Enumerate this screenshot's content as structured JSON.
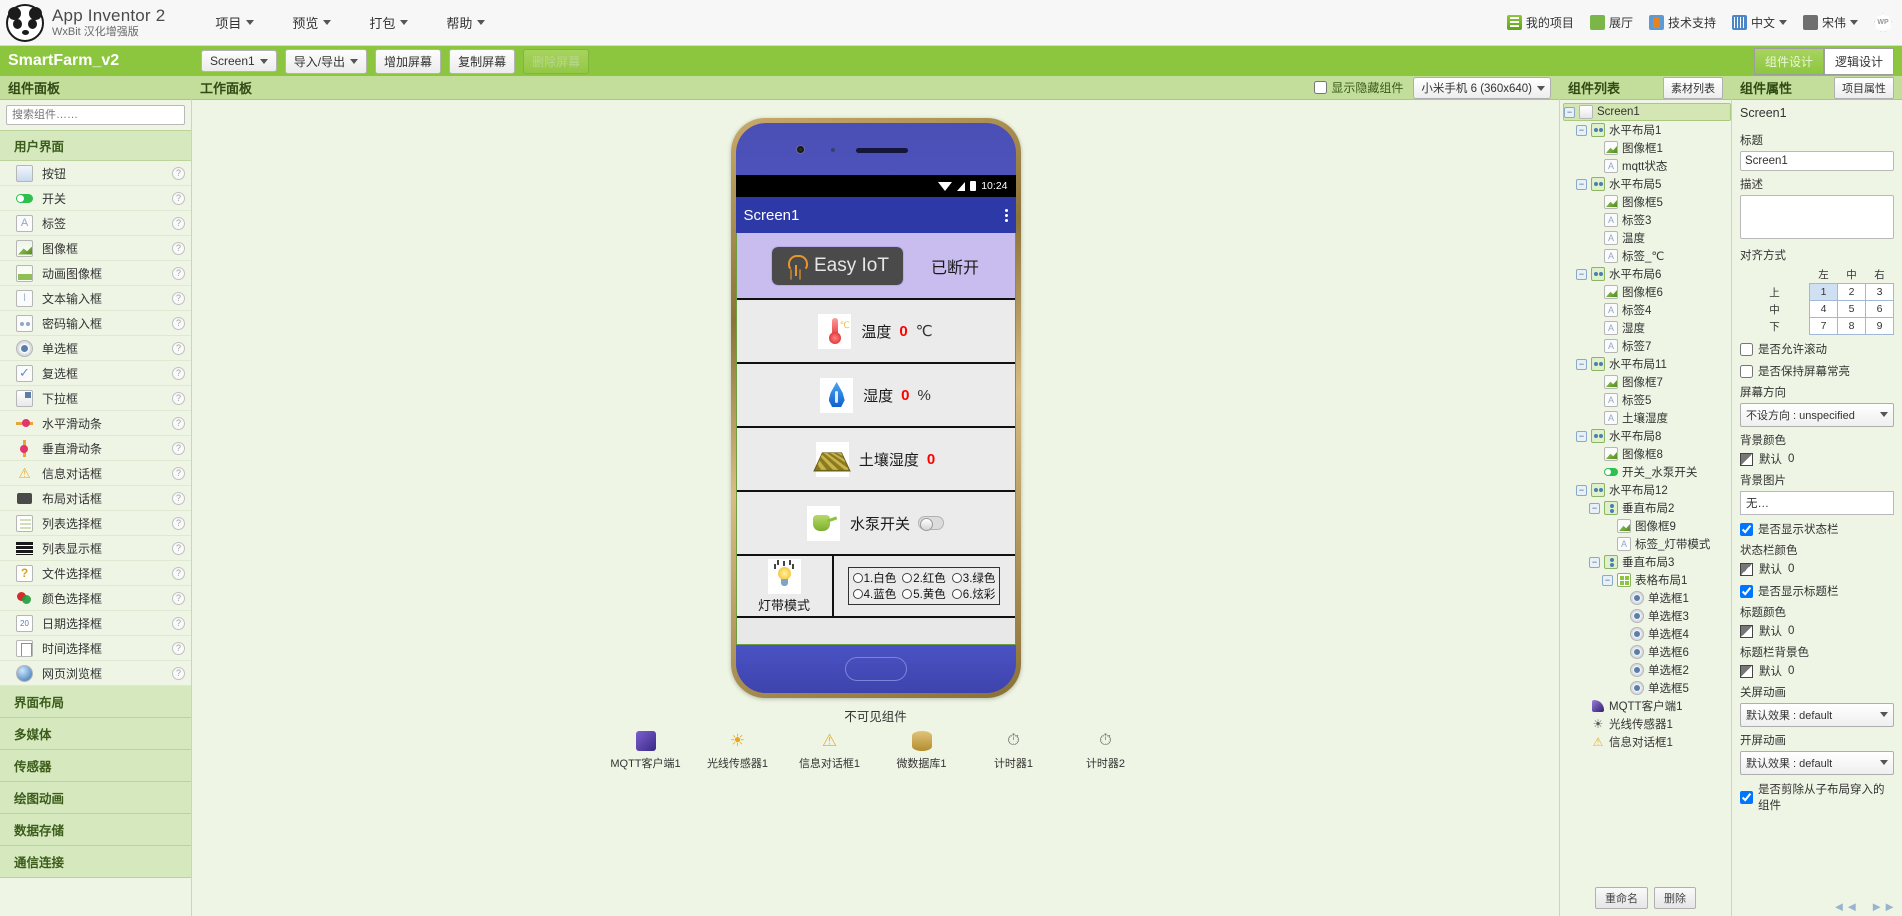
{
  "topbar": {
    "brand_title": "App Inventor 2",
    "brand_sub": "WxBit 汉化增强版",
    "menus": [
      "项目",
      "预览",
      "打包",
      "帮助"
    ],
    "right_items": [
      "我的项目",
      "展厅",
      "技术支持",
      "中文",
      "宋伟"
    ],
    "badge": "WP"
  },
  "projectbar": {
    "project_name": "SmartFarm_v2",
    "screen_select": "Screen1",
    "import_export": "导入/导出",
    "add_screen": "增加屏幕",
    "copy_screen": "复制屏幕",
    "delete_screen": "删除屏幕",
    "designer_tab": "组件设计",
    "blocks_tab": "逻辑设计"
  },
  "palette": {
    "header": "组件面板",
    "search_placeholder": "搜索组件……",
    "category_ui": "用户界面",
    "components": [
      {
        "label": "按钮",
        "icon": "button-icon"
      },
      {
        "label": "开关",
        "icon": "switch-icon"
      },
      {
        "label": "标签",
        "icon": "label-icon"
      },
      {
        "label": "图像框",
        "icon": "image-icon"
      },
      {
        "label": "动画图像框",
        "icon": "animated-image-icon"
      },
      {
        "label": "文本输入框",
        "icon": "textbox-icon"
      },
      {
        "label": "密码输入框",
        "icon": "password-icon"
      },
      {
        "label": "单选框",
        "icon": "radio-icon"
      },
      {
        "label": "复选框",
        "icon": "checkbox-icon"
      },
      {
        "label": "下拉框",
        "icon": "spinner-icon"
      },
      {
        "label": "水平滑动条",
        "icon": "horizontal-slider-icon"
      },
      {
        "label": "垂直滑动条",
        "icon": "vertical-slider-icon"
      },
      {
        "label": "信息对话框",
        "icon": "notifier-icon"
      },
      {
        "label": "布局对话框",
        "icon": "dialog-icon"
      },
      {
        "label": "列表选择框",
        "icon": "listpicker-icon"
      },
      {
        "label": "列表显示框",
        "icon": "listview-icon"
      },
      {
        "label": "文件选择框",
        "icon": "filepicker-icon"
      },
      {
        "label": "颜色选择框",
        "icon": "colorpicker-icon"
      },
      {
        "label": "日期选择框",
        "icon": "datepicker-icon"
      },
      {
        "label": "时间选择框",
        "icon": "timepicker-icon"
      },
      {
        "label": "网页浏览框",
        "icon": "webviewer-icon"
      }
    ],
    "other_categories": [
      "界面布局",
      "多媒体",
      "传感器",
      "绘图动画",
      "数据存储",
      "通信连接"
    ]
  },
  "viewer": {
    "header": "工作面板",
    "show_hidden_label": "显示隐藏组件",
    "device_select": "小米手机 6 (360x640)"
  },
  "phone": {
    "status_time": "10:24",
    "title": "Screen1",
    "mqtt_button": "Easy IoT",
    "mqtt_status": "已断开",
    "rows": [
      {
        "icon": "thermometer-icon",
        "label": "温度",
        "value": "0",
        "unit": "℃"
      },
      {
        "icon": "water-drop-icon",
        "label": "湿度",
        "value": "0",
        "unit": "%"
      },
      {
        "icon": "soil-icon",
        "label": "土壤湿度",
        "value": "0",
        "unit": ""
      }
    ],
    "pump_label": "水泵开关",
    "led_label": "灯带模式",
    "led_options": [
      "1.白色",
      "2.红色",
      "3.绿色",
      "4.蓝色",
      "5.黄色",
      "6.炫彩"
    ]
  },
  "invisible": {
    "title": "不可见组件",
    "items": [
      {
        "name": "MQTT客户端1",
        "icon": "mqtt-icon"
      },
      {
        "name": "光线传感器1",
        "icon": "lightsensor-icon"
      },
      {
        "name": "信息对话框1",
        "icon": "notifier-icon"
      },
      {
        "name": "微数据库1",
        "icon": "tinydb-icon"
      },
      {
        "name": "计时器1",
        "icon": "clock-icon"
      },
      {
        "name": "计时器2",
        "icon": "clock-icon"
      }
    ]
  },
  "tree": {
    "header": "组件列表",
    "assets_button": "素材列表",
    "nodes": [
      {
        "label": "Screen1",
        "depth": 0,
        "icon": "screen-icon",
        "expander": "minus",
        "selected": true
      },
      {
        "label": "水平布局1",
        "depth": 1,
        "icon": "harrangement-icon",
        "expander": "minus"
      },
      {
        "label": "图像框1",
        "depth": 2,
        "icon": "image-icon",
        "expander": "none"
      },
      {
        "label": "mqtt状态",
        "depth": 2,
        "icon": "label-icon",
        "expander": "none"
      },
      {
        "label": "水平布局5",
        "depth": 1,
        "icon": "harrangement-icon",
        "expander": "minus"
      },
      {
        "label": "图像框5",
        "depth": 2,
        "icon": "image-icon",
        "expander": "none"
      },
      {
        "label": "标签3",
        "depth": 2,
        "icon": "label-icon",
        "expander": "none"
      },
      {
        "label": "温度",
        "depth": 2,
        "icon": "label-icon",
        "expander": "none"
      },
      {
        "label": "标签_℃",
        "depth": 2,
        "icon": "label-icon",
        "expander": "none"
      },
      {
        "label": "水平布局6",
        "depth": 1,
        "icon": "harrangement-icon",
        "expander": "minus"
      },
      {
        "label": "图像框6",
        "depth": 2,
        "icon": "image-icon",
        "expander": "none"
      },
      {
        "label": "标签4",
        "depth": 2,
        "icon": "label-icon",
        "expander": "none"
      },
      {
        "label": "湿度",
        "depth": 2,
        "icon": "label-icon",
        "expander": "none"
      },
      {
        "label": "标签7",
        "depth": 2,
        "icon": "label-icon",
        "expander": "none"
      },
      {
        "label": "水平布局11",
        "depth": 1,
        "icon": "harrangement-icon",
        "expander": "minus"
      },
      {
        "label": "图像框7",
        "depth": 2,
        "icon": "image-icon",
        "expander": "none"
      },
      {
        "label": "标签5",
        "depth": 2,
        "icon": "label-icon",
        "expander": "none"
      },
      {
        "label": "土壤湿度",
        "depth": 2,
        "icon": "label-icon",
        "expander": "none"
      },
      {
        "label": "水平布局8",
        "depth": 1,
        "icon": "harrangement-icon",
        "expander": "minus"
      },
      {
        "label": "图像框8",
        "depth": 2,
        "icon": "image-icon",
        "expander": "none"
      },
      {
        "label": "开关_水泵开关",
        "depth": 2,
        "icon": "switch-icon",
        "expander": "none"
      },
      {
        "label": "水平布局12",
        "depth": 1,
        "icon": "harrangement-icon",
        "expander": "minus"
      },
      {
        "label": "垂直布局2",
        "depth": 2,
        "icon": "varrangement-icon",
        "expander": "minus"
      },
      {
        "label": "图像框9",
        "depth": 3,
        "icon": "image-icon",
        "expander": "none"
      },
      {
        "label": "标签_灯带模式",
        "depth": 3,
        "icon": "label-icon",
        "expander": "none"
      },
      {
        "label": "垂直布局3",
        "depth": 2,
        "icon": "varrangement-icon",
        "expander": "minus"
      },
      {
        "label": "表格布局1",
        "depth": 3,
        "icon": "table-icon",
        "expander": "minus"
      },
      {
        "label": "单选框1",
        "depth": 4,
        "icon": "radio-icon",
        "expander": "none"
      },
      {
        "label": "单选框3",
        "depth": 4,
        "icon": "radio-icon",
        "expander": "none"
      },
      {
        "label": "单选框4",
        "depth": 4,
        "icon": "radio-icon",
        "expander": "none"
      },
      {
        "label": "单选框6",
        "depth": 4,
        "icon": "radio-icon",
        "expander": "none"
      },
      {
        "label": "单选框2",
        "depth": 4,
        "icon": "radio-icon",
        "expander": "none"
      },
      {
        "label": "单选框5",
        "depth": 4,
        "icon": "radio-icon",
        "expander": "none"
      },
      {
        "label": "MQTT客户端1",
        "depth": 1,
        "icon": "mqtt-icon",
        "expander": "none"
      },
      {
        "label": "光线传感器1",
        "depth": 1,
        "icon": "lightsensor-icon",
        "expander": "none"
      },
      {
        "label": "信息对话框1",
        "depth": 1,
        "icon": "notifier-icon",
        "expander": "none"
      }
    ],
    "rename_button": "重命名",
    "delete_button": "删除"
  },
  "properties": {
    "header": "组件属性",
    "project_props_button": "项目属性",
    "component_name": "Screen1",
    "title_label": "标题",
    "title_value": "Screen1",
    "desc_label": "描述",
    "desc_value": "",
    "align_label": "对齐方式",
    "align_cols": [
      "左",
      "中",
      "右"
    ],
    "align_rows": [
      "上",
      "中",
      "下"
    ],
    "align_cells": [
      "1",
      "2",
      "3",
      "4",
      "5",
      "6",
      "7",
      "8",
      "9"
    ],
    "align_selected": "1",
    "scrollable_label": "是否允许滚动",
    "scrollable_checked": false,
    "keep_screen_on_label": "是否保持屏幕常亮",
    "keep_screen_on_checked": false,
    "orientation_label": "屏幕方向",
    "orientation_value": "不设方向 : unspecified",
    "bgcolor_label": "背景颜色",
    "bgcolor_value": "默认",
    "bgcolor_extra": "0",
    "bgimage_label": "背景图片",
    "bgimage_value": "无…",
    "show_statusbar_label": "是否显示状态栏",
    "show_statusbar_checked": true,
    "statusbar_color_label": "状态栏颜色",
    "statusbar_color_value": "默认",
    "statusbar_color_extra": "0",
    "show_titlebar_label": "是否显示标题栏",
    "show_titlebar_checked": true,
    "titlebar_color_label": "标题颜色",
    "titlebar_color_value": "默认",
    "titlebar_color_extra": "0",
    "titlebar_bg_label": "标题栏背景色",
    "titlebar_bg_value": "默认",
    "titlebar_bg_extra": "0",
    "close_anim_label": "关屏动画",
    "close_anim_value": "默认效果 : default",
    "open_anim_label": "开屏动画",
    "open_anim_value": "默认效果 : default",
    "clip_label": "是否剪除从子布局穿入的组件",
    "clip_checked": true
  }
}
